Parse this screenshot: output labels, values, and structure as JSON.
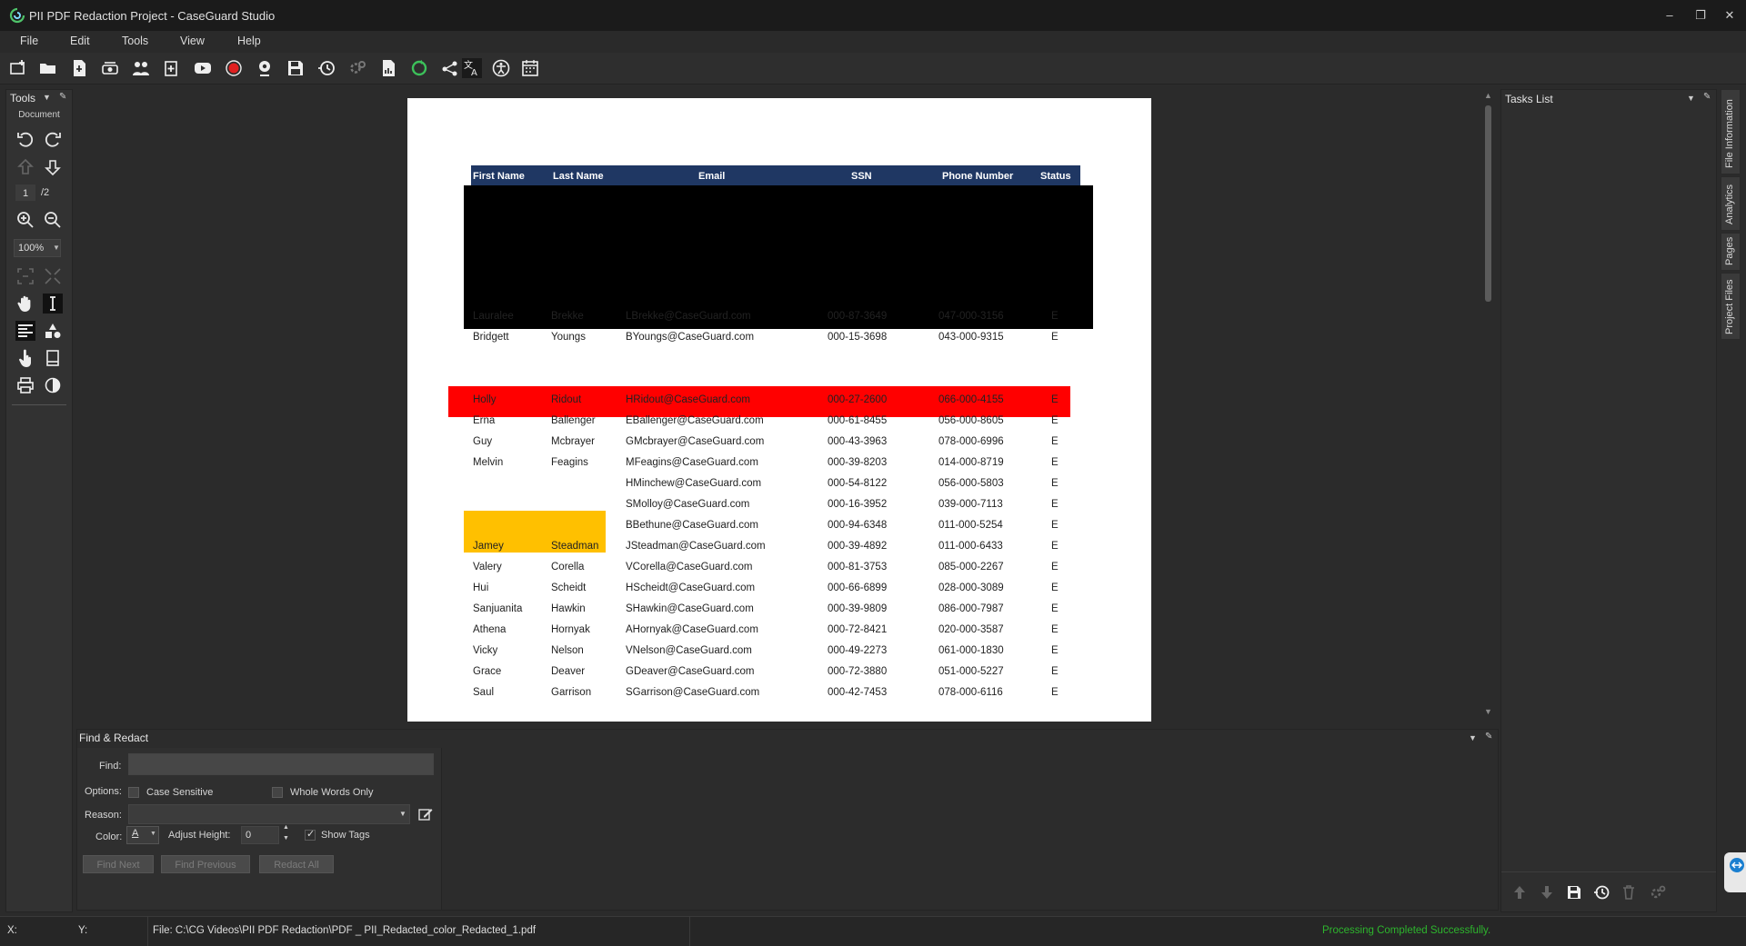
{
  "window": {
    "title": "PII PDF Redaction Project - CaseGuard Studio",
    "minimize": "–",
    "restore": "❐",
    "close": "✕"
  },
  "menu": [
    "File",
    "Edit",
    "Tools",
    "View",
    "Help"
  ],
  "toolbar_icons": [
    "new-project-icon",
    "open-folder-icon",
    "import-file-icon",
    "scanner-icon",
    "people-icon",
    "add-file-icon",
    "youtube-icon",
    "record-icon",
    "webcam-icon",
    "save-icon",
    "history-icon",
    "settings-icon",
    "report-icon",
    "refresh-icon",
    "share-icon",
    "translate-icon",
    "accessibility-icon",
    "calendar-icon"
  ],
  "tools_panel": {
    "title": "Tools",
    "section": "Document",
    "current_page": "1",
    "total_pages": "/2",
    "zoom": "100%"
  },
  "document": {
    "columns": [
      "First Name",
      "Last Name",
      "Email",
      "SSN",
      "Phone Number",
      "Status"
    ],
    "rows": [
      [
        "Lauralee",
        "Brekke",
        "LBrekke@CaseGuard.com",
        "000-87-3649",
        "047-000-3156",
        "E"
      ],
      [
        "Bridgett",
        "Youngs",
        "BYoungs@CaseGuard.com",
        "000-15-3698",
        "043-000-9315",
        "E"
      ],
      [
        "Holly",
        "Ridout",
        "HRidout@CaseGuard.com",
        "000-27-2600",
        "066-000-4155",
        "E"
      ],
      [
        "Erna",
        "Ballenger",
        "EBallenger@CaseGuard.com",
        "000-61-8455",
        "056-000-8605",
        "E"
      ],
      [
        "Guy",
        "Mcbrayer",
        "GMcbrayer@CaseGuard.com",
        "000-43-3963",
        "078-000-6996",
        "E"
      ],
      [
        "Melvin",
        "Feagins",
        "MFeagins@CaseGuard.com",
        "000-39-8203",
        "014-000-8719",
        "E"
      ],
      [
        "",
        "",
        "HMinchew@CaseGuard.com",
        "000-54-8122",
        "056-000-5803",
        "E"
      ],
      [
        "",
        "",
        "SMolloy@CaseGuard.com",
        "000-16-3952",
        "039-000-7113",
        "E"
      ],
      [
        "",
        "",
        "BBethune@CaseGuard.com",
        "000-94-6348",
        "011-000-5254",
        "E"
      ],
      [
        "Jamey",
        "Steadman",
        "JSteadman@CaseGuard.com",
        "000-39-4892",
        "011-000-6433",
        "E"
      ],
      [
        "Valery",
        "Corella",
        "VCorella@CaseGuard.com",
        "000-81-3753",
        "085-000-2267",
        "E"
      ],
      [
        "Hui",
        "Scheidt",
        "HScheidt@CaseGuard.com",
        "000-66-6899",
        "028-000-3089",
        "E"
      ],
      [
        "Sanjuanita",
        "Hawkin",
        "SHawkin@CaseGuard.com",
        "000-39-9809",
        "086-000-7987",
        "E"
      ],
      [
        "Athena",
        "Hornyak",
        "AHornyak@CaseGuard.com",
        "000-72-8421",
        "020-000-3587",
        "E"
      ],
      [
        "Vicky",
        "Nelson",
        "VNelson@CaseGuard.com",
        "000-49-2273",
        "061-000-1830",
        "E"
      ],
      [
        "Grace",
        "Deaver",
        "GDeaver@CaseGuard.com",
        "000-72-3880",
        "051-000-5227",
        "E"
      ],
      [
        "Saul",
        "Garrison",
        "SGarrison@CaseGuard.com",
        "000-42-7453",
        "078-000-6116",
        "E"
      ]
    ],
    "redaction_colors": {
      "black": "#000000",
      "red": "#ff0000",
      "amber": "#ffc000"
    }
  },
  "tasks_panel": {
    "title": "Tasks List"
  },
  "side_tabs": [
    "File Information",
    "Analytics",
    "Pages",
    "Project Files"
  ],
  "find_redact": {
    "title": "Find & Redact",
    "find_label": "Find:",
    "find_value": "",
    "options_label": "Options:",
    "case_sensitive": "Case Sensitive",
    "whole_words": "Whole Words Only",
    "reason_label": "Reason:",
    "color_label": "Color:",
    "color_glyph": "A",
    "adjust_height_label": "Adjust Height:",
    "adjust_height_value": "0",
    "show_tags": "Show Tags",
    "find_next": "Find Next",
    "find_previous": "Find Previous",
    "redact_all": "Redact All"
  },
  "status": {
    "x_label": "X:",
    "y_label": "Y:",
    "file": "File: C:\\CG Videos\\PII PDF Redaction\\PDF _ PII_Redacted_color_Redacted_1.pdf",
    "message": "Processing Completed Successfully.",
    "message_color": "#2db52d"
  }
}
